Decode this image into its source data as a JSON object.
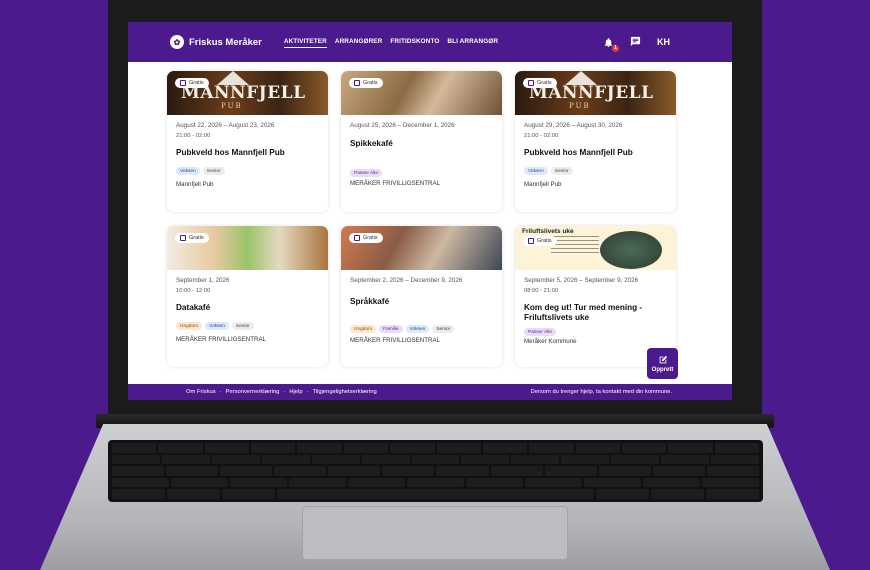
{
  "header": {
    "logo_text": "Friskus Meråker",
    "nav": [
      "AKTIVITETER",
      "ARRANGØRER",
      "FRITIDSKONTO",
      "BLI ARRANGØR"
    ],
    "notification_count": "1",
    "user_initials": "KH"
  },
  "cards": [
    {
      "badge": "Gratis",
      "dates": "August 22, 2026  –  August 23, 2026",
      "time": "21:00 - 02:00",
      "title": "Pubkveld hos Mannfjell Pub",
      "tags": [
        "Voksen",
        "Senior"
      ],
      "organizer": "Mannfjell Pub",
      "image_text": "MANNFJELL",
      "image_sub": "PUB"
    },
    {
      "badge": "Gratis",
      "dates": "August 25, 2026  –  December 1, 2026",
      "time": "",
      "title": "Spikkekafé",
      "tags": [
        "Passer Alle"
      ],
      "organizer": "MERÅKER FRIVILLIGSENTRAL"
    },
    {
      "badge": "Gratis",
      "dates": "August 29, 2026  –  August 30, 2026",
      "time": "21:00 - 02:00",
      "title": "Pubkveld hos Mannfjell Pub",
      "tags": [
        "Voksen",
        "Senior"
      ],
      "organizer": "Mannfjell Pub",
      "image_text": "MANNFJELL",
      "image_sub": "PUB"
    },
    {
      "badge": "Gratis",
      "dates": "September 1, 2026",
      "time": "10:00 - 12:00",
      "title": "Datakafé",
      "tags": [
        "Ungdom",
        "Voksen",
        "Senior"
      ],
      "organizer": "MERÅKER FRIVILLIGSENTRAL"
    },
    {
      "badge": "Gratis",
      "dates": "September 2, 2026  –  December 9, 2026",
      "time": "",
      "title": "Språkkafé",
      "tags": [
        "Ungdom",
        "Familie",
        "Voksen",
        "Senior"
      ],
      "organizer": "MERÅKER FRIVILLIGSENTRAL"
    },
    {
      "badge": "Gratis",
      "dates": "September 5, 2026  –  September 9, 2026",
      "time": "08:00 - 21:00",
      "title": "Kom deg ut! Tur med mening - Friluftslivets uke",
      "tags": [
        "Passer Alle"
      ],
      "organizer": "Meråker Kommune",
      "image_text": "Friluftslivets uke"
    }
  ],
  "fab_label": "Opprett",
  "footer": {
    "links": [
      "Om Friskus",
      "·",
      "Personvernerklæring",
      "·",
      "Hjelp",
      "·",
      "Tilgjengelighetserklæring"
    ],
    "help_text": "Dersom du trenger hjelp, ta kontakt med din kommune."
  },
  "colors": {
    "brand": "#4b1a8c",
    "background": "#4b1a8c"
  }
}
